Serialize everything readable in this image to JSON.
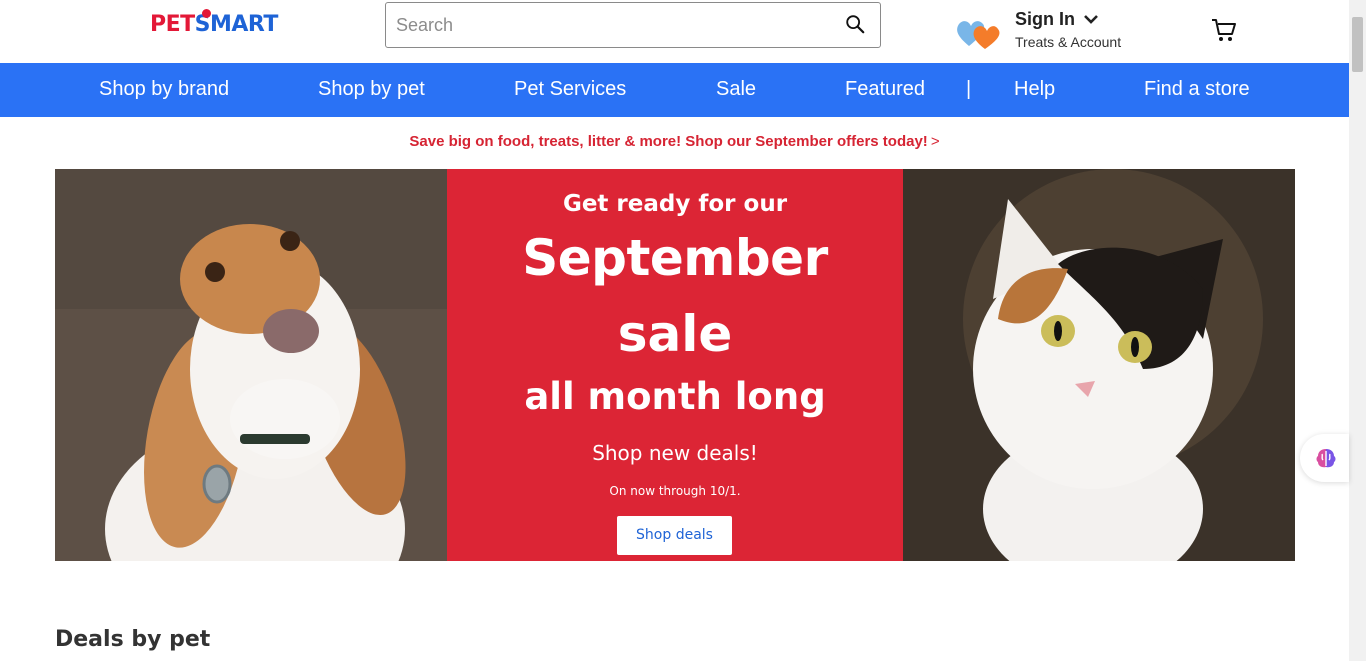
{
  "header": {
    "logo": {
      "text_left": "PET",
      "text_right": "SMART"
    },
    "search": {
      "placeholder": "Search",
      "value": ""
    },
    "account": {
      "title": "Sign In",
      "subtitle": "Treats & Account"
    }
  },
  "nav": {
    "items": [
      "Shop by brand",
      "Shop by pet",
      "Pet Services",
      "Sale",
      "Featured",
      "Help",
      "Find a store"
    ],
    "separator": "|"
  },
  "promo": {
    "text": "Save big on food, treats, litter & more! Shop our September offers today!",
    "arrow": ">"
  },
  "hero": {
    "line1": "Get ready for our",
    "line2": "September",
    "line3": "sale",
    "line4": "all month long",
    "line5": "Shop new deals!",
    "line6": "On now through 10/1.",
    "button": "Shop deals"
  },
  "section": {
    "title": "Deals by pet"
  },
  "colors": {
    "nav_blue": "#2a72f5",
    "brand_red": "#dc2535",
    "promo_red": "#d62433",
    "link_blue": "#1e63d6"
  },
  "icons": [
    "search-icon",
    "hearts-icon",
    "chevron-down-icon",
    "cart-icon",
    "brain-icon"
  ]
}
